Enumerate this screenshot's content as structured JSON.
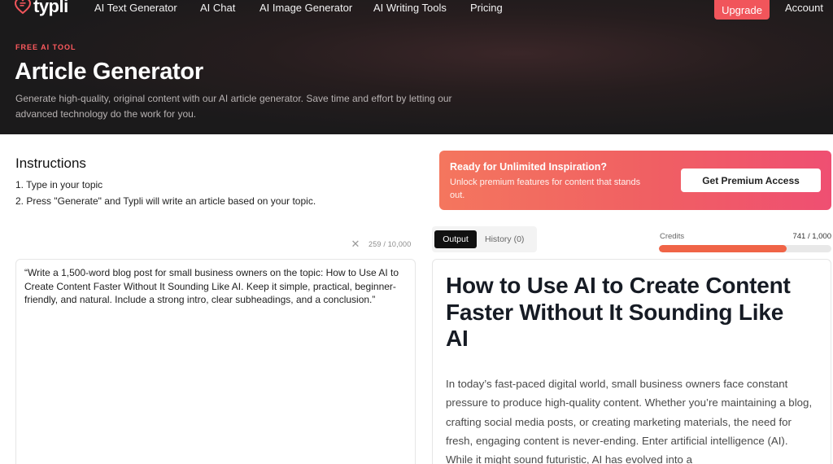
{
  "nav": {
    "brand": "typli",
    "links": [
      "AI Text Generator",
      "AI Chat",
      "AI Image Generator",
      "AI Writing Tools",
      "Pricing"
    ],
    "upgrade": "Upgrade",
    "account": "Account"
  },
  "hero": {
    "eyebrow": "FREE AI TOOL",
    "title": "Article Generator",
    "subtitle": "Generate high-quality, original content with our AI article generator. Save time and effort by letting our advanced technology do the work for you."
  },
  "instructions": {
    "title": "Instructions",
    "steps": [
      "1. Type in your topic",
      "2. Press \"Generate\" and Typli will write an article based on your topic."
    ]
  },
  "input": {
    "char_count": "259 / 10,000",
    "value": "“Write a 1,500-word blog post for small business owners on the topic: How to Use AI to Create Content Faster Without It Sounding Like AI. Keep it simple, practical, beginner-friendly, and natural. Include a strong intro, clear subheadings, and a conclusion.”"
  },
  "promo": {
    "title": "Ready for Unlimited Inspiration?",
    "subtitle": "Unlock premium features for content that stands out.",
    "button": "Get Premium Access"
  },
  "tabs": {
    "output": "Output",
    "history": "History (0)"
  },
  "credits": {
    "label": "Credits",
    "value": "741 / 1,000",
    "fraction": 0.741
  },
  "output": {
    "title": "How to Use AI to Create Content Faster Without It Sounding Like AI",
    "body": "In today’s fast-paced digital world, small business owners face constant pressure to produce high-quality content. Whether you’re maintaining a blog, crafting social media posts, or creating marketing materials, the need for fresh, engaging content is never-ending. Enter artificial intelligence (AI). While it might sound futuristic, AI has evolved into a"
  },
  "colors": {
    "accent": "#f1555b",
    "eyebrow": "#ff5a5f",
    "hero_bg": "#1b1a1b",
    "credits_fill": "#f06447"
  }
}
